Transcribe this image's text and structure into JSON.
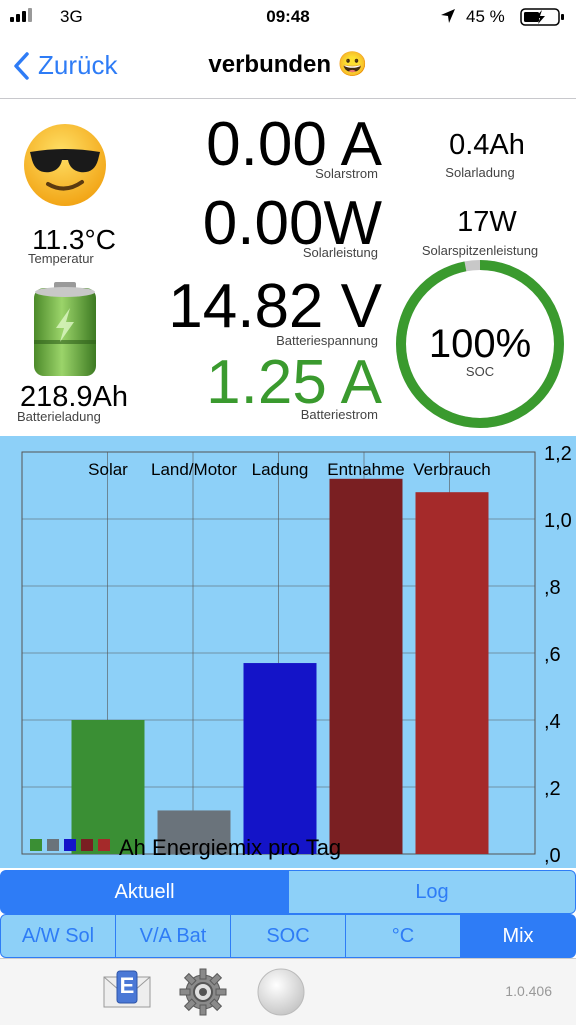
{
  "status": {
    "carrier": "3G",
    "time": "09:48",
    "battery_percent": "45 %"
  },
  "nav": {
    "back_label": "Zurück",
    "title": "verbunden 😀"
  },
  "left": {
    "temp_value": "11.3°C",
    "temp_label": "Temperatur",
    "charge_value": "218.9Ah",
    "charge_label": "Batterieladung"
  },
  "readings": {
    "solar_current": "0.00 A",
    "solar_current_label": "Solarstrom",
    "solar_power": "0.00W",
    "solar_power_label": "Solarleistung",
    "battery_voltage": "14.82 V",
    "battery_voltage_label": "Batteriespannung",
    "battery_current": "1.25 A",
    "battery_current_label": "Batteriestrom"
  },
  "right": {
    "solar_charge": "0.4Ah",
    "solar_charge_label": "Solarladung",
    "solar_peak": "17W",
    "solar_peak_label": "Solarspitzenleistung",
    "soc_value": "100%",
    "soc_label": "SOC",
    "soc_fraction": 0.97
  },
  "chart_data": {
    "type": "bar",
    "categories": [
      "Solar",
      "Land/Motor",
      "Ladung",
      "Entnahme",
      "Verbrauch"
    ],
    "values": [
      0.4,
      0.13,
      0.57,
      1.12,
      1.08
    ],
    "colors": [
      "#3a8f34",
      "#6a737b",
      "#1414c8",
      "#7a1f22",
      "#a52a2a"
    ],
    "yticks": [
      ",0",
      ",2",
      ",4",
      ",6",
      ",8",
      "1,0",
      "1,2"
    ],
    "ylim": [
      0,
      1.2
    ],
    "legend_label": "Ah Energiemix pro Tag"
  },
  "tabs_top": [
    {
      "label": "Aktuell",
      "active": true
    },
    {
      "label": "Log",
      "active": false
    }
  ],
  "tabs_bottom": [
    {
      "label": "A/W Sol",
      "active": false
    },
    {
      "label": "V/A Bat",
      "active": false
    },
    {
      "label": "SOC",
      "active": false
    },
    {
      "label": "°C",
      "active": false
    },
    {
      "label": "Mix",
      "active": true
    }
  ],
  "footer": {
    "mail_letter": "E",
    "version": "1.0.406"
  },
  "theme": {
    "accent": "#2e7cf6",
    "green": "#3a9a2e",
    "tab_active": "#2e7cf6",
    "tab_bg": "#8dd0f8"
  }
}
